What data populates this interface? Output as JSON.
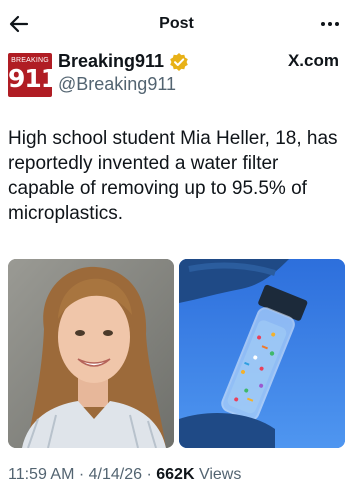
{
  "header": {
    "title": "Post",
    "back_icon": "arrow-left-icon",
    "more_icon": "more-horizontal-icon"
  },
  "author": {
    "avatar_text_small": "BREAKING",
    "avatar_text_large": "911",
    "avatar_color": "#b01d24",
    "display_name": "Breaking911",
    "handle": "@Breaking911",
    "verified_icon": "verified-badge-icon",
    "verified_color": "#e8b117",
    "source": "X.com"
  },
  "post": {
    "text": "High school student Mia Heller, 18, has reportedly invented a water filter capable of removing up to 95.5% of microplastics."
  },
  "media": [
    {
      "subject": "portrait-photo"
    },
    {
      "subject": "vial-of-microplastics-photo"
    }
  ],
  "meta": {
    "time": "11:59 AM",
    "sep1": " · ",
    "date": "4/14/26",
    "sep2": " · ",
    "views_count": "662K",
    "views_label": " Views"
  }
}
